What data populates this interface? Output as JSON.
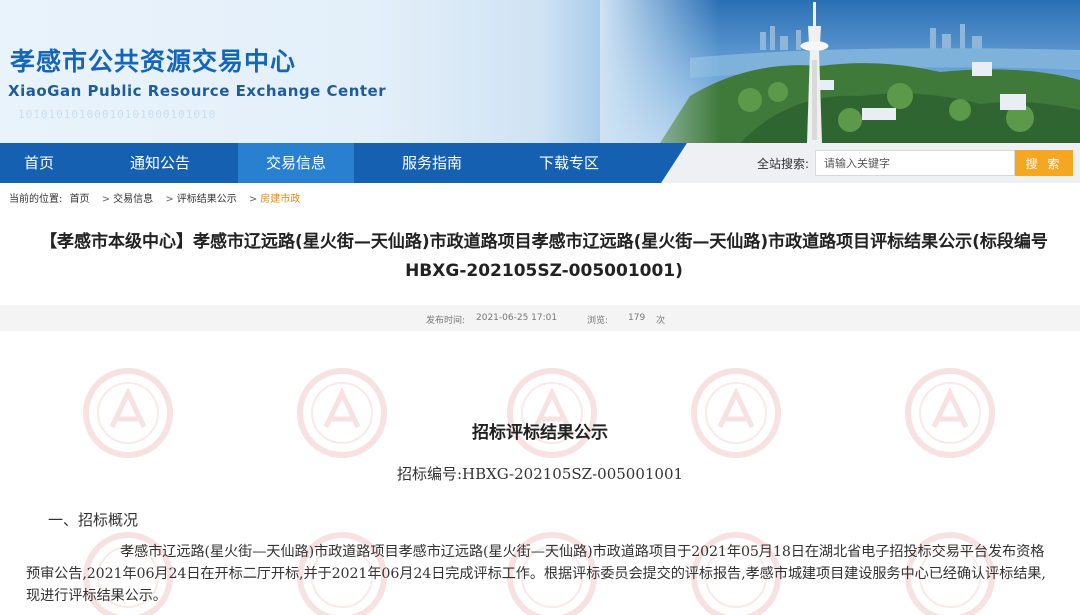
{
  "header": {
    "title_cn": "孝感市公共资源交易中心",
    "title_en": "XiaoGan Public Resource Exchange Center"
  },
  "nav": {
    "items": [
      {
        "label": "首页"
      },
      {
        "label": "通知公告"
      },
      {
        "label": "交易信息",
        "active": true
      },
      {
        "label": "服务指南"
      },
      {
        "label": "下载专区"
      }
    ],
    "search_label": "全站搜索:",
    "search_placeholder": "请输入关键字",
    "search_button": "搜 索"
  },
  "breadcrumb": {
    "prefix": "当前的位置:",
    "items": [
      "首页",
      "交易信息",
      "评标结果公示",
      "房建市政"
    ]
  },
  "article": {
    "title": "【孝感市本级中心】孝感市辽远路(星火街—天仙路)市政道路项目孝感市辽远路(星火街—天仙路)市政道路项目评标结果公示(标段编号HBXG-202105SZ-005001001)",
    "publish_label": "发布时间:",
    "publish_time": "2021-06-25 17:01",
    "views_label": "浏览:",
    "views_count": "179",
    "views_unit": "次"
  },
  "document": {
    "heading": "招标评标结果公示",
    "code_line": "招标编号:HBXG-202105SZ-005001001",
    "section_1_title": "一、招标概况",
    "section_1_body": "孝感市辽远路(星火街—天仙路)市政道路项目孝感市辽远路(星火街—天仙路)市政道路项目于2021年05月18日在湖北省电子招投标交易平台发布资格预审公告,2021年06月24日在开标二厅开标,并于2021年06月24日完成评标工作。根据评标委员会提交的评标报告,孝感市城建项目建设服务中心已经确认评标结果,现进行评标结果公示。"
  },
  "colors": {
    "nav_bg": "#1560b0",
    "nav_active": "#2a80d0",
    "search_button": "#f5a623",
    "breadcrumb_current": "#e8891a",
    "brand_blue": "#1565b8"
  }
}
